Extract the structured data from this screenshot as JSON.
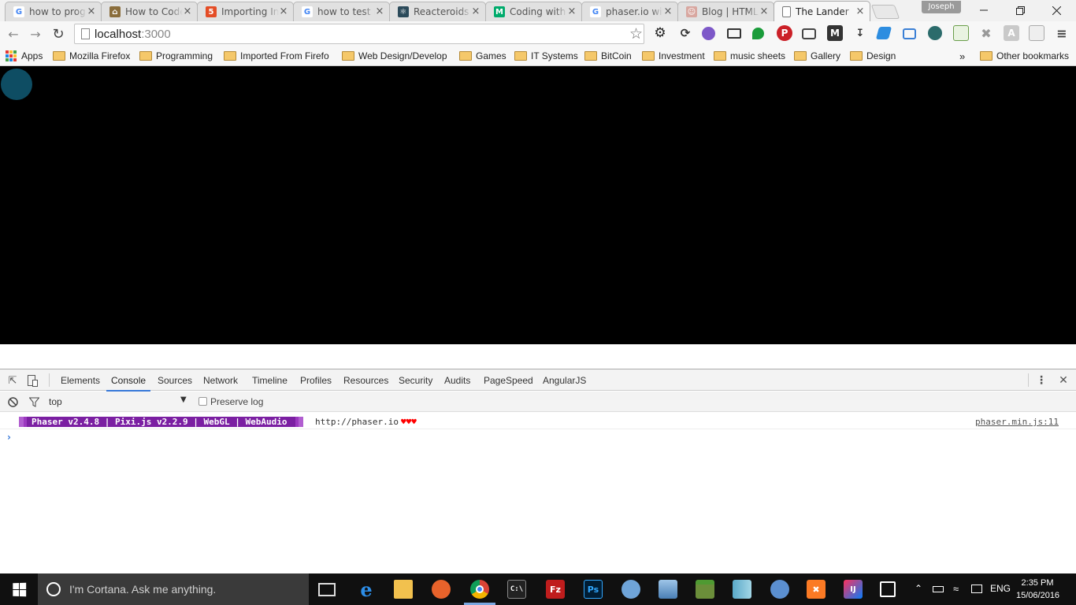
{
  "browser": {
    "tabs": [
      {
        "title": "how to prog",
        "favicon": "google-icon",
        "color": "#4285f4",
        "glyph": "G"
      },
      {
        "title": "How to Code",
        "favicon": "house-icon",
        "color": "#8a6d3b",
        "glyph": "⌂"
      },
      {
        "title": "Importing In",
        "favicon": "html5-icon",
        "color": "#e44d26",
        "glyph": "5"
      },
      {
        "title": "how to test r",
        "favicon": "google-icon",
        "color": "#4285f4",
        "glyph": "G"
      },
      {
        "title": "Reacteroids",
        "favicon": "react-icon",
        "color": "#2b4a5a",
        "glyph": "⚛"
      },
      {
        "title": "Coding with",
        "favicon": "medium-icon",
        "color": "#00ab6c",
        "glyph": "M"
      },
      {
        "title": "phaser.io wit",
        "favicon": "google-icon",
        "color": "#4285f4",
        "glyph": "G"
      },
      {
        "title": "Blog | HTML",
        "favicon": "person-icon",
        "color": "#d8a7a0",
        "glyph": "☺"
      },
      {
        "title": "The Lander",
        "favicon": "page-icon",
        "color": "#ffffff",
        "glyph": ""
      }
    ],
    "profile_name": "Joseph",
    "url_host": "localhost",
    "url_port": ":3000"
  },
  "bookmarks": {
    "apps_label": "Apps",
    "items": [
      "Mozilla Firefox",
      "Programming",
      "Imported From Firefo",
      "Web Design/Develop",
      "Games",
      "IT Systems",
      "BitCoin",
      "Investment",
      "music sheets",
      "Gallery",
      "Design"
    ],
    "overflow": "»",
    "other_label": "Other bookmarks"
  },
  "devtools": {
    "tabs": [
      "Elements",
      "Console",
      "Sources",
      "Network",
      "Timeline",
      "Profiles",
      "Resources",
      "Security",
      "Audits",
      "PageSpeed",
      "AngularJS"
    ],
    "active_tab": "Console",
    "context": "top",
    "preserve_log": "Preserve log",
    "log": {
      "banner": "Phaser v2.4.8 | Pixi.js v2.2.9 | WebGL | WebAudio",
      "url": "http://phaser.io",
      "hearts": "♥♥♥",
      "source": "phaser.min.js:11"
    },
    "prompt": "›"
  },
  "taskbar": {
    "cortana_text": "I'm Cortana. Ask me anything.",
    "language": "ENG",
    "time": "2:35 PM",
    "date": "15/06/2016"
  },
  "colors": {
    "accent": "#3879d9",
    "lander": "#0e4d63",
    "phaser_purple": "#7b1fa2"
  }
}
